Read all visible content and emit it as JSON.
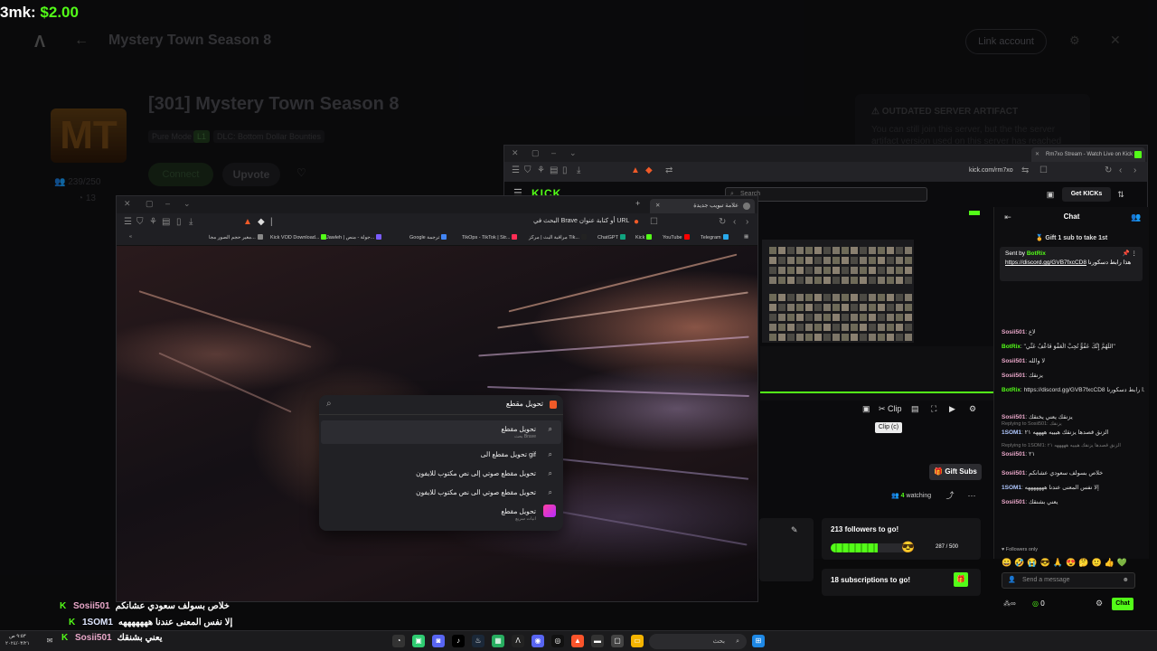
{
  "overlay": {
    "bmk_label": "3mk:",
    "bmk_value": "$2.00",
    "chat": [
      {
        "user": "Sosii501",
        "text": "خلاص بسولف سعودي عشانكم"
      },
      {
        "user": "1SOM1",
        "text": "إلا نفس المعنى عندنا هههههههه"
      },
      {
        "user": "Sosii501",
        "text": "يعني بشنقك"
      }
    ]
  },
  "launcher": {
    "title": "Mystery Town Season 8",
    "link_account": "Link account",
    "server_logo": "MT",
    "server_title": "[301] Mystery Town Season 8",
    "tags": [
      "Pure Mode",
      "L1",
      "DLC: Bottom Dollar Bounties"
    ],
    "connect": "Connect",
    "upvote": "Upvote",
    "players": "239/250",
    "players2": "13",
    "outdated_title": "OUTDATED SERVER ARTIFACT",
    "outdated_text": "You can still join this server, but the the server artifact version used on this server has reached"
  },
  "kick_window": {
    "tab_title": "Rm7xo Stream - Watch Live on Kick",
    "url": "kick.com/rm7xo",
    "logo": "KICK",
    "search_placeholder": "Search",
    "get_kicks": "Get KICKs",
    "clip_tooltip": "Clip (c)",
    "clip_label": "Clip",
    "gift_subs": "Gift Subs",
    "watching_count": "4",
    "watching_label": "watching",
    "goal1_title": "213 followers to go!",
    "goal1_progress": "287 / 500",
    "goal1_fraction": 0.574,
    "goal2_title": "18 subscriptions to go!",
    "chat": {
      "title": "Chat",
      "gift_banner": "Gift 1 sub to take 1st",
      "pinned_by": "Sent by",
      "pinned_user": "BotRix",
      "pinned_link": "https://discord.gg/GVB7fxcCD8",
      "pinned_text": "هذا رابط دسكورنا",
      "messages": [
        {
          "reply": "",
          "user": "Sosii501",
          "color": "#e9a7c9",
          "text": "لاع"
        },
        {
          "reply": "",
          "user": "BotRix",
          "color": "#53fc18",
          "text": "\"اللَّهُمَّ إِنَّكَ عَفُوٌّ تُحِبُّ الْعَفْوَ فَاعْفُ عَنِّي\""
        },
        {
          "reply": "",
          "user": "Sosii501",
          "color": "#e9a7c9",
          "text": "لا والله"
        },
        {
          "reply": "",
          "user": "Sosii501",
          "color": "#e9a7c9",
          "text": "يزنقك"
        },
        {
          "reply": "",
          "user": "BotRix",
          "color": "#53fc18",
          "text": "https://discord.gg/GVB7fxcCD8 هذا رابط دسكورنا"
        },
        {
          "reply": "",
          "user": "Sosii501",
          "color": "#e9a7c9",
          "text": "يزنقك يعني يخنقك"
        },
        {
          "reply": "Replying to Sosii501: يزنقك",
          "user": "1SOM1",
          "color": "#b0c8ff",
          "text": "الزنق قصدها يزنقك هيييه ههههه ٢١"
        },
        {
          "reply": "Replying to 1SOM1: الزنق قصدها يزنقك هيييه هههههه ٢١",
          "user": "Sosii501",
          "color": "#e9a7c9",
          "text": "٢١"
        },
        {
          "reply": "",
          "user": "Sosii501",
          "color": "#e9a7c9",
          "text": "خلاص بسولف سعودي عشانكم"
        },
        {
          "reply": "",
          "user": "1SOM1",
          "color": "#b0c8ff",
          "text": "إلا نفس المعنى عندنا هههههههه"
        },
        {
          "reply": "",
          "user": "Sosii501",
          "color": "#e9a7c9",
          "text": "يعني بشنقك"
        }
      ],
      "followers_only": "Followers only",
      "send_placeholder": "Send a message",
      "kicks": "0",
      "chat_button": "Chat"
    }
  },
  "brave_window": {
    "tab_title": "علامة تبويب جديدة",
    "url_placeholder": "البحث في Brave أو كتابة عنوان URL",
    "bookmarks": [
      "مغير حجم الصور مجا...",
      "Kick VOD Download...",
      "Jawleh | جولة - منص...",
      "Google ترجمة",
      "TikOps - TikTok | Str...",
      "مراقبة البث | مركز Tik...",
      "ChatGPT",
      "Kick",
      "YouTube",
      "Telegram"
    ],
    "search_query": "تحويل مقطع",
    "suggestions": [
      {
        "text": "تحويل مقطع",
        "sub": "بحث Brave"
      },
      {
        "text": "تحويل مقطع الى gif",
        "sub": ""
      },
      {
        "text": "تحويل مقطع صوتي إلى نص مكتوب للايفون",
        "sub": ""
      },
      {
        "text": "تحويل مقطع صوتي الى نص مكتوب للايفون",
        "sub": ""
      },
      {
        "text": "تحويل مقطع",
        "sub": "انيات سريع"
      }
    ]
  },
  "taskbar": {
    "clock_time": "٩:٥٣ ص",
    "clock_date": "٢٠٢٤/٠٣/٢١",
    "search": "بحث"
  }
}
